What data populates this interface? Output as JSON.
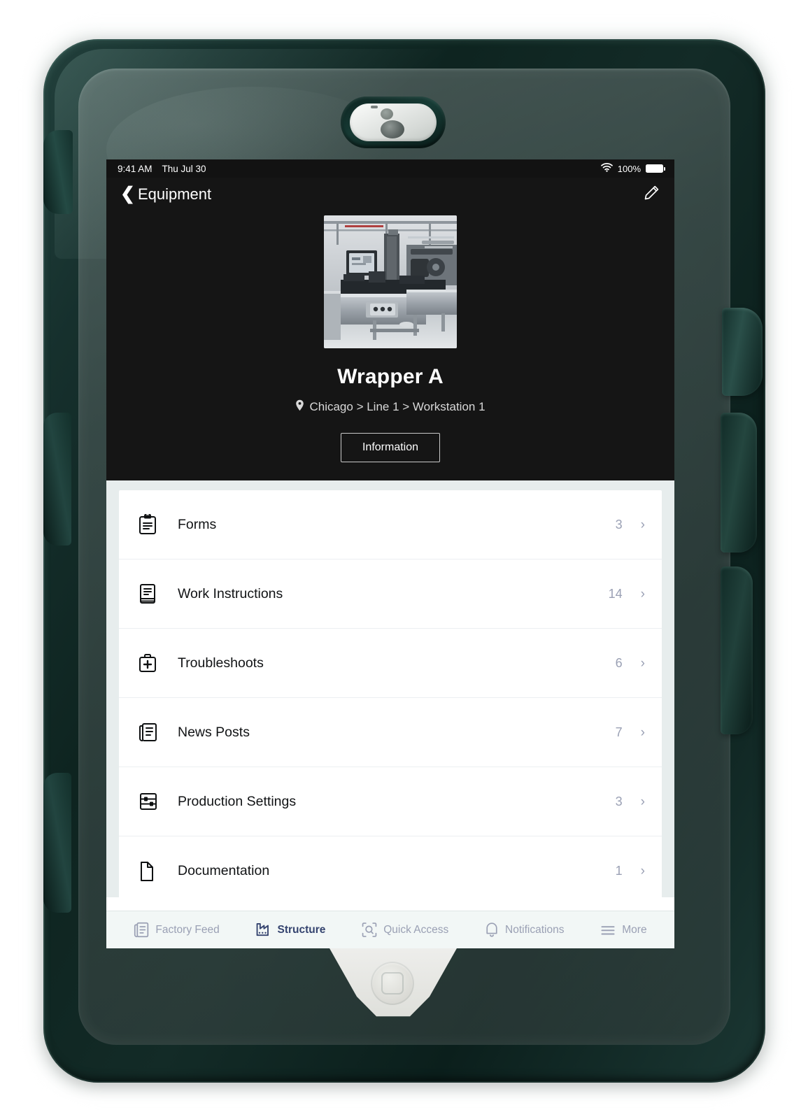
{
  "status_bar": {
    "time": "9:41 AM",
    "date": "Thu Jul 30",
    "wifi_icon": "wifi-icon",
    "battery_percent": "100%",
    "battery_icon": "battery-full-icon"
  },
  "nav": {
    "back_chevron": "❮",
    "back_label": "Equipment",
    "edit_icon": "pencil-edit-icon"
  },
  "hero": {
    "photo_alt": "industrial-packaging-machine-photo",
    "title": "Wrapper A",
    "location_icon": "map-pin-icon",
    "breadcrumb": "Chicago > Line 1 > Workstation 1",
    "action_label": "Information"
  },
  "list": {
    "rows": [
      {
        "icon": "clipboard-icon",
        "label": "Forms",
        "count": "3",
        "chevron": "›"
      },
      {
        "icon": "book-icon",
        "label": "Work Instructions",
        "count": "14",
        "chevron": "›"
      },
      {
        "icon": "first-aid-kit-icon",
        "label": "Troubleshoots",
        "count": "6",
        "chevron": "›"
      },
      {
        "icon": "newspaper-icon",
        "label": "News Posts",
        "count": "7",
        "chevron": "›"
      },
      {
        "icon": "sliders-settings-icon",
        "label": "Production Settings",
        "count": "3",
        "chevron": "›"
      },
      {
        "icon": "file-page-icon",
        "label": "Documentation",
        "count": "1",
        "chevron": "›"
      }
    ]
  },
  "tabbar": {
    "items": [
      {
        "icon": "feed-document-icon",
        "label": "Factory Feed",
        "active": false
      },
      {
        "icon": "factory-icon",
        "label": "Structure",
        "active": true
      },
      {
        "icon": "scan-search-icon",
        "label": "Quick Access",
        "active": false
      },
      {
        "icon": "bell-icon",
        "label": "Notifications",
        "active": false
      },
      {
        "icon": "hamburger-more-icon",
        "label": "More",
        "active": false
      }
    ]
  },
  "colors": {
    "hero_background": "#151515",
    "page_background": "#e7eded",
    "card_background": "#ffffff",
    "accent_active_tab": "#35446f",
    "muted_text": "#9aa0b4",
    "case_body": "#143029"
  },
  "device": {
    "case_description": "rugged-dark-green-tablet-case",
    "home_button": "home-button",
    "camera": "front-camera"
  }
}
